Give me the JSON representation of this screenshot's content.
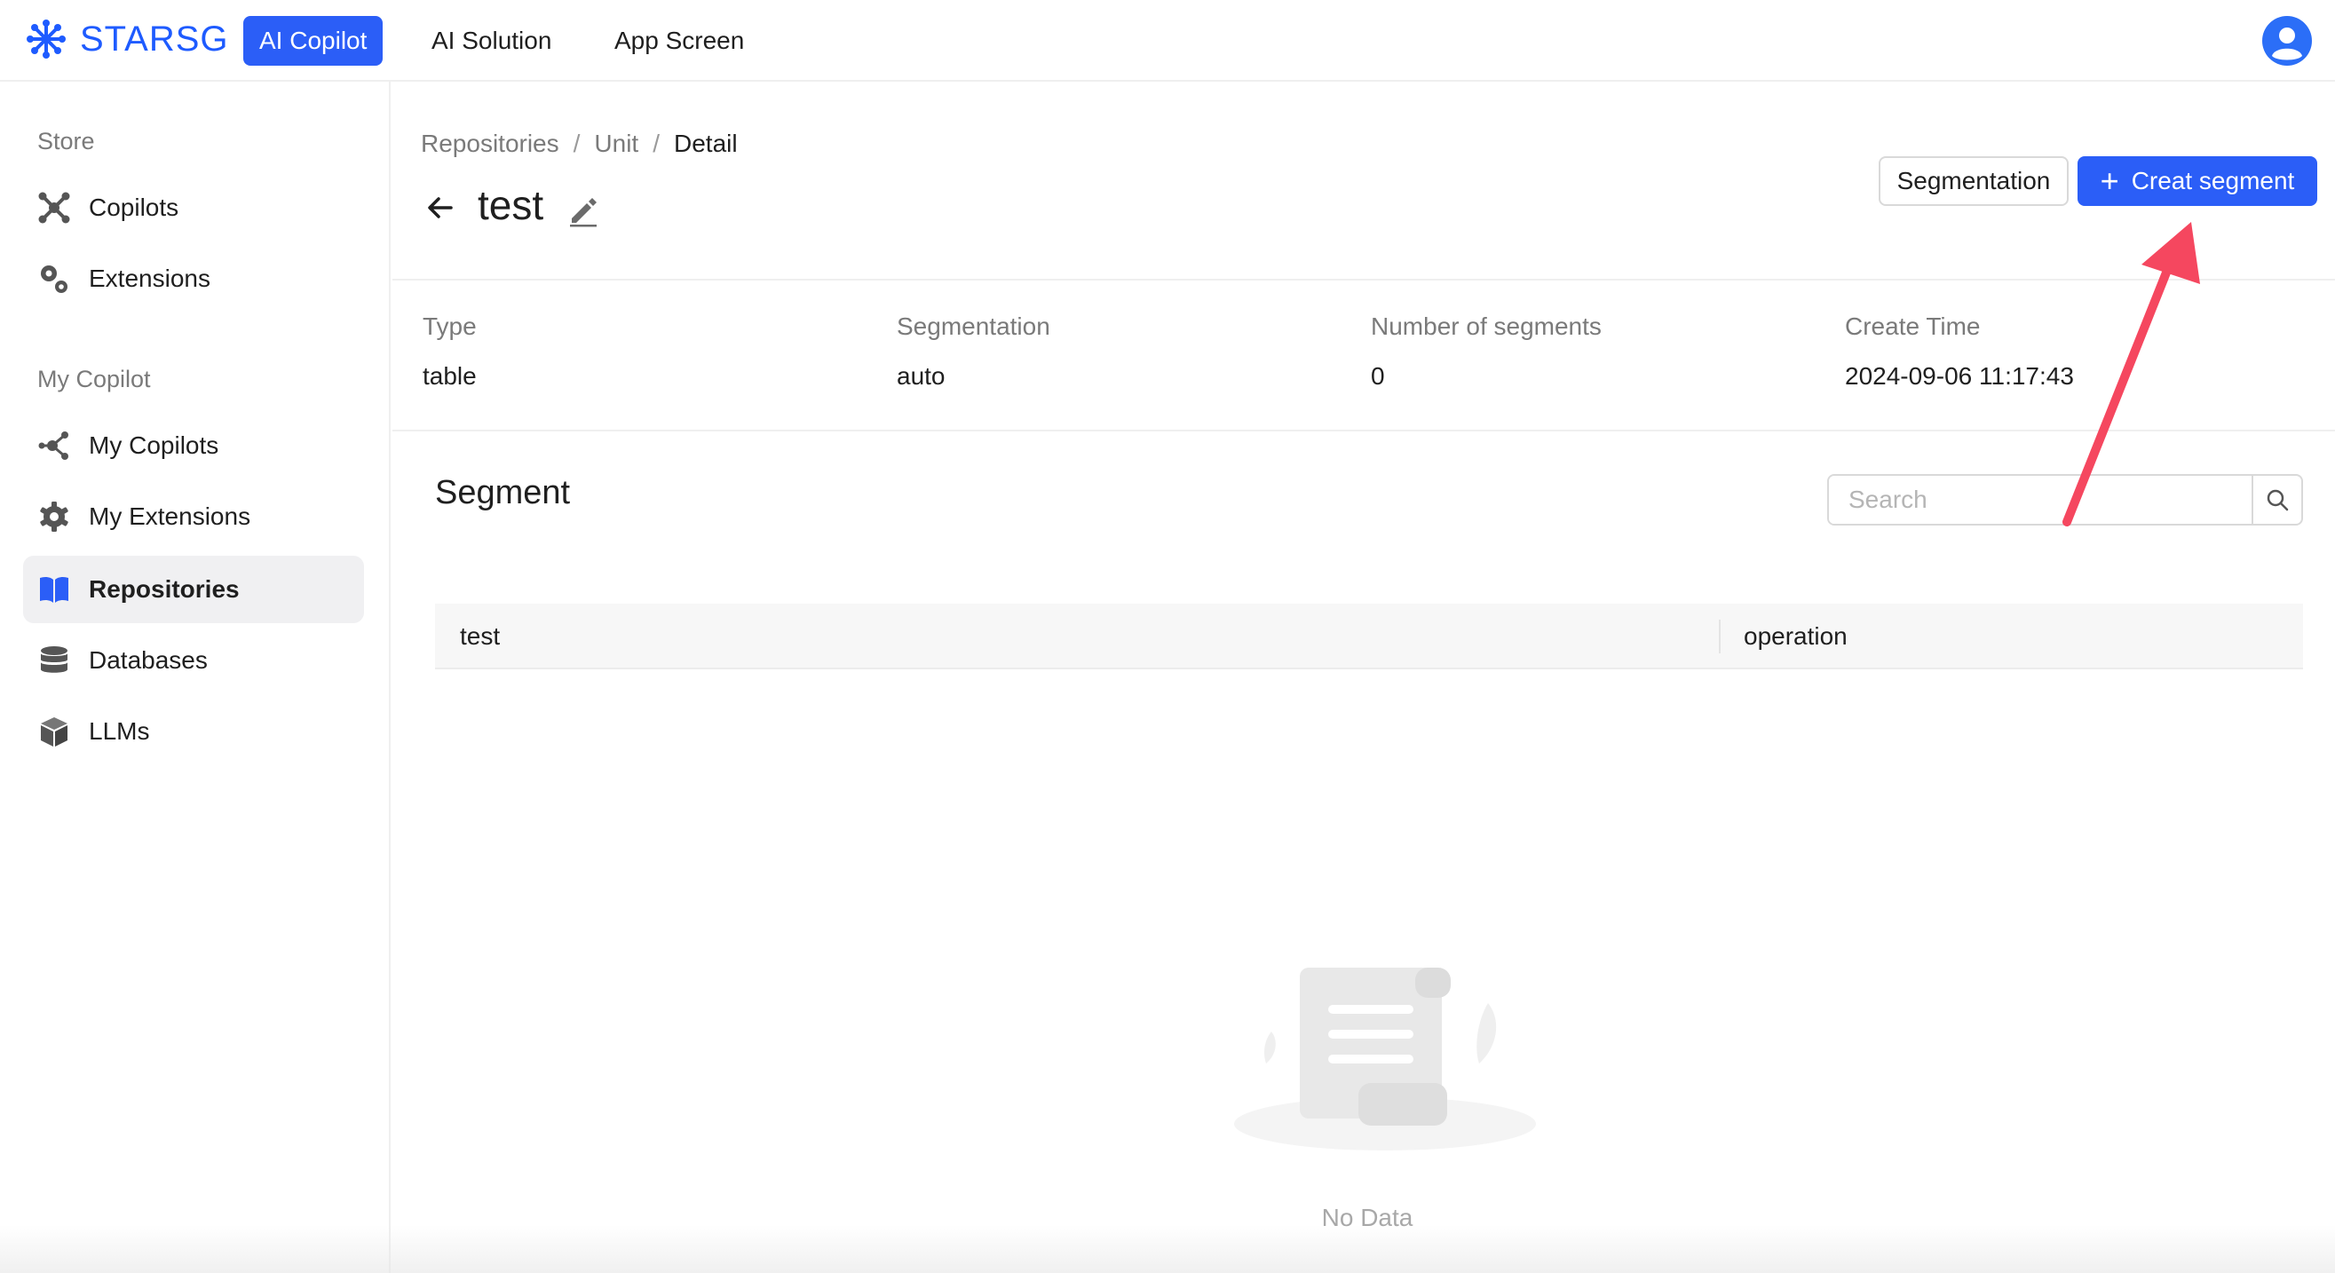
{
  "topbar": {
    "brand": "STARSG",
    "nav": [
      {
        "label": "AI Copilot",
        "active": true
      },
      {
        "label": "AI Solution",
        "active": false
      },
      {
        "label": "App Screen",
        "active": false
      }
    ]
  },
  "sidebar": {
    "groups": [
      {
        "title": "Store",
        "items": [
          {
            "label": "Copilots",
            "icon": "hub-icon"
          },
          {
            "label": "Extensions",
            "icon": "gears-icon"
          }
        ]
      },
      {
        "title": "My Copilot",
        "items": [
          {
            "label": "My Copilots",
            "icon": "share-nodes-icon"
          },
          {
            "label": "My Extensions",
            "icon": "gear-icon"
          },
          {
            "label": "Repositories",
            "icon": "book-icon",
            "active": true
          },
          {
            "label": "Databases",
            "icon": "database-icon"
          },
          {
            "label": "LLMs",
            "icon": "cube-icon"
          }
        ]
      }
    ]
  },
  "breadcrumb": [
    "Repositories",
    "Unit",
    "Detail"
  ],
  "page": {
    "title": "test",
    "segmentation_button": "Segmentation",
    "create_button": "Creat segment"
  },
  "info": [
    {
      "label": "Type",
      "value": "table"
    },
    {
      "label": "Segmentation",
      "value": "auto"
    },
    {
      "label": "Number of segments",
      "value": "0"
    },
    {
      "label": "Create Time",
      "value": "2024-09-06 11:17:43"
    }
  ],
  "segment": {
    "title": "Segment",
    "search_placeholder": "Search",
    "columns": [
      "test",
      "operation"
    ],
    "empty_text": "No Data"
  },
  "colors": {
    "accent": "#2b5ef7",
    "brand": "#1e5bff",
    "annotation_arrow": "#f5475f"
  }
}
